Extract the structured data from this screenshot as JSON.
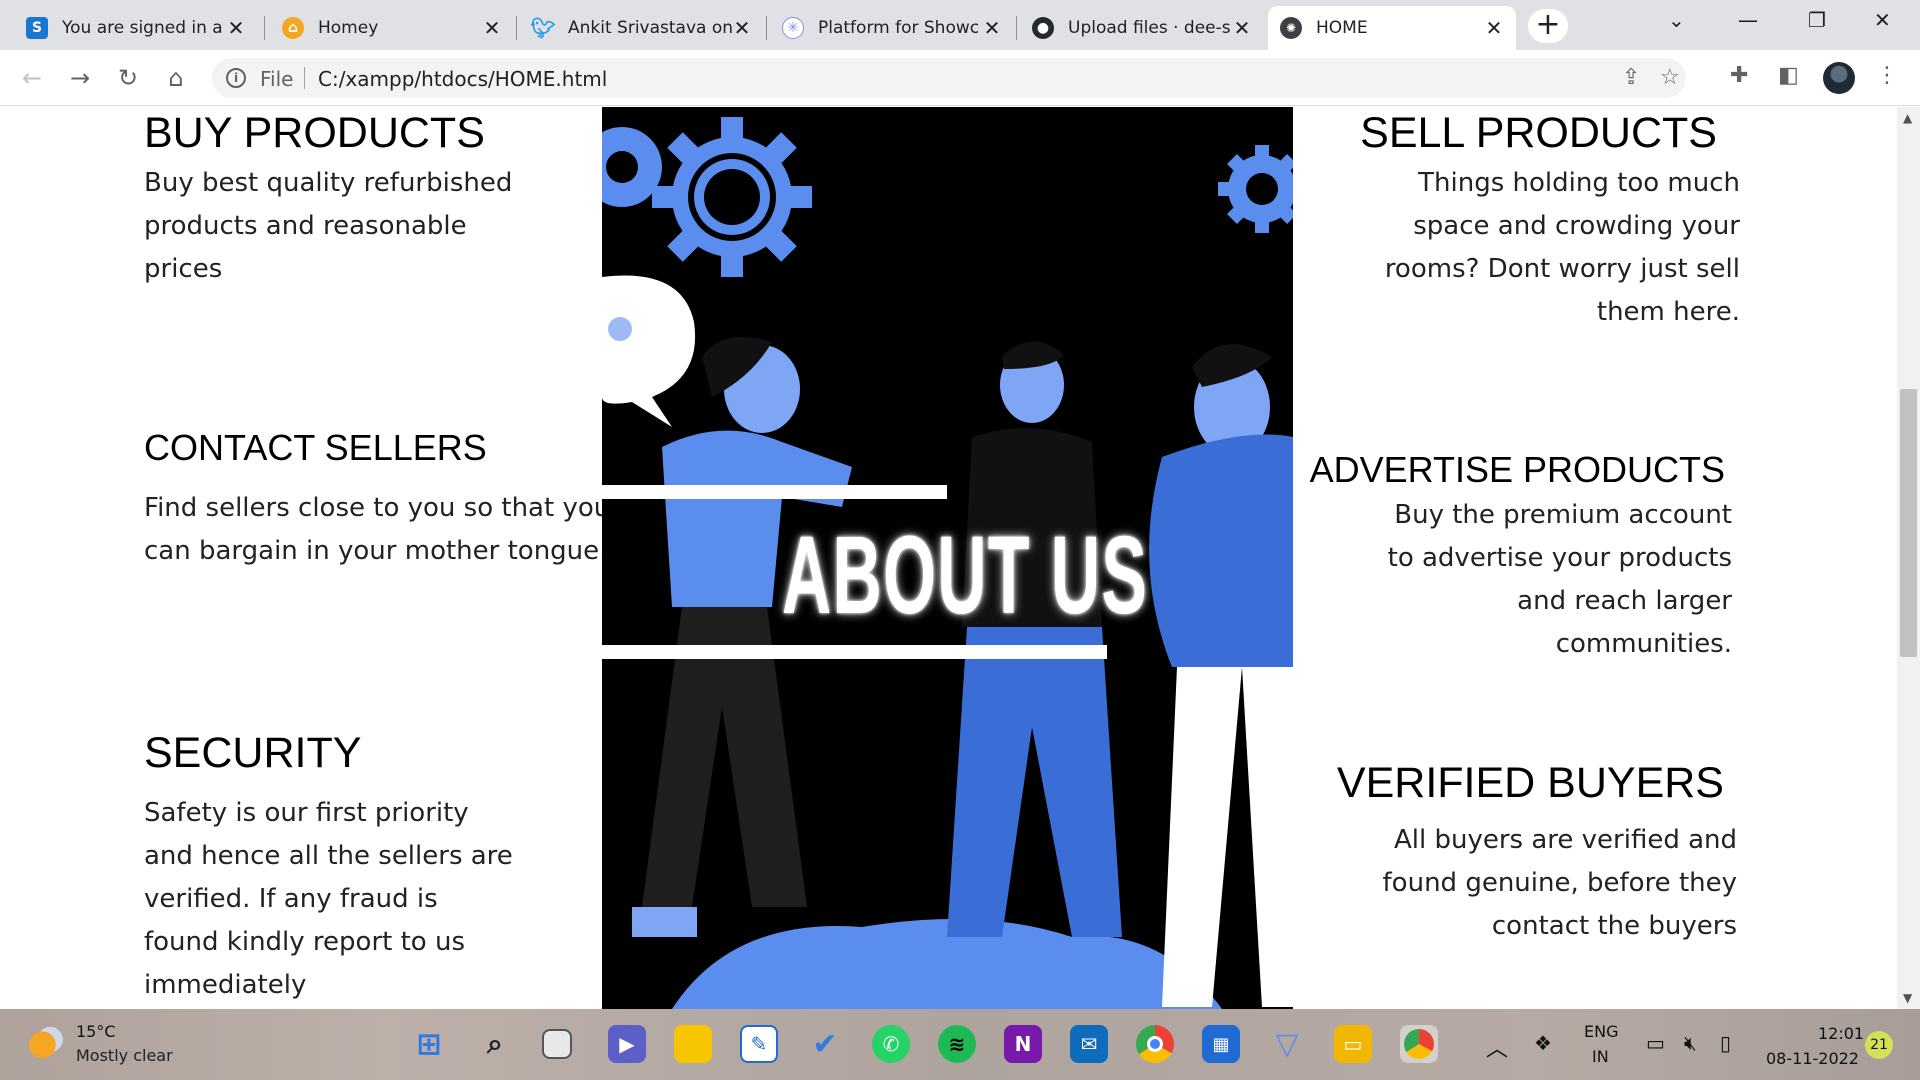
{
  "browser": {
    "tabs": [
      {
        "title": "You are signed in a",
        "favicon": "s-icon",
        "favicon_color": "#1976d2",
        "active": false
      },
      {
        "title": "Homey",
        "favicon": "home-icon",
        "favicon_color": "#f5a623",
        "active": false
      },
      {
        "title": "Ankit Srivastava on",
        "favicon": "twitter-icon",
        "favicon_color": "#1d9bf0",
        "active": false
      },
      {
        "title": "Platform for Showc",
        "favicon": "sparkle-icon",
        "favicon_color": "#8a8de8",
        "active": false
      },
      {
        "title": "Upload files · dee-s",
        "favicon": "github-icon",
        "favicon_color": "#24292f",
        "active": false
      },
      {
        "title": "HOME",
        "favicon": "globe-icon",
        "favicon_color": "#3c4043",
        "active": true
      }
    ],
    "address": {
      "scheme_label": "File",
      "url": "C:/xampp/htdocs/HOME.html"
    }
  },
  "page": {
    "left": [
      {
        "heading": "BUY PRODUCTS",
        "lines": [
          "Buy best quality refurbished",
          "products and reasonable",
          "prices"
        ]
      },
      {
        "heading": "CONTACT SELLERS",
        "lines": [
          "Find sellers close to you so that you",
          "can bargain in your mother tongue."
        ]
      },
      {
        "heading": "SECURITY",
        "lines": [
          "Safety is our first priority",
          "and hence all the sellers are",
          "verified. If any fraud is",
          "found kindly report to us",
          "immediately"
        ]
      }
    ],
    "right": [
      {
        "heading": "SELL PRODUCTS",
        "lines": [
          "Things holding too much",
          "space and crowding your",
          "rooms? Dont worry just sell",
          "them here."
        ]
      },
      {
        "heading": "ADVERTISE PRODUCTS",
        "lines": [
          "Buy the premium account",
          "to advertise your products",
          "and reach larger",
          "communities."
        ]
      },
      {
        "heading": "VERIFIED BUYERS",
        "lines": [
          "All buyers are verified and",
          "found genuine, before they",
          "contact the buyers"
        ]
      }
    ],
    "hero": {
      "title": "ABOUT US",
      "accent_color": "#5b8def"
    }
  },
  "taskbar": {
    "weather": {
      "temp": "15°C",
      "desc": "Mostly clear"
    },
    "apps": [
      "windows-start-icon",
      "search-icon",
      "task-view-icon",
      "teams-chat-icon",
      "sticky-notes-icon",
      "whiteboard-icon",
      "todo-icon",
      "whatsapp-icon",
      "spotify-icon",
      "onenote-icon",
      "mail-icon",
      "chrome-icon",
      "calendar-icon",
      "vpn-icon",
      "file-explorer-icon",
      "chrome-profile-icon"
    ],
    "tray": {
      "language_top": "ENG",
      "language_bottom": "IN",
      "time": "12:01",
      "date": "08-11-2022",
      "notifications": "21"
    }
  }
}
